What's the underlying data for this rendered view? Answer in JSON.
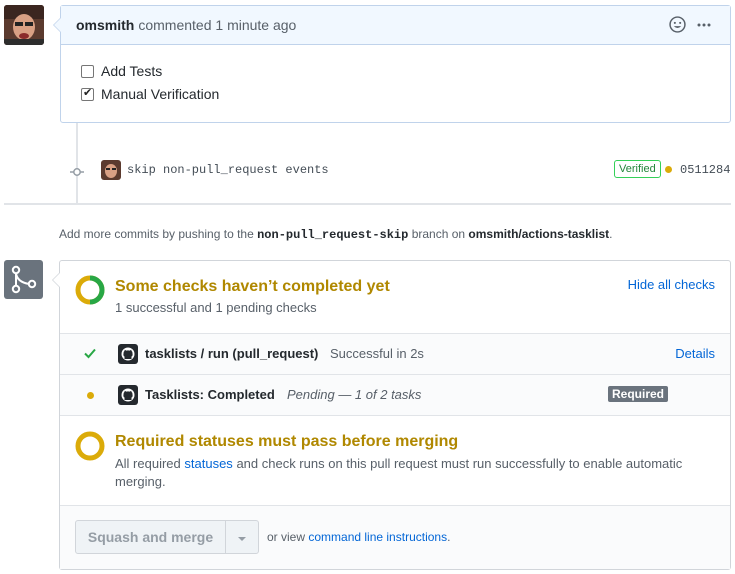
{
  "comment": {
    "author": "omsmith",
    "action": "commented",
    "time": "1 minute ago",
    "tasks": [
      {
        "label": "Add Tests",
        "checked": false
      },
      {
        "label": "Manual Verification",
        "checked": true
      }
    ]
  },
  "commit": {
    "message": "skip non-pull_request events",
    "verified_label": "Verified",
    "sha": "0511284"
  },
  "push_hint": {
    "prefix": "Add more commits by pushing to the",
    "branch": "non-pull_request-skip",
    "middle": "branch on",
    "repo": "omsmith/actions-tasklist",
    "suffix": "."
  },
  "checks": {
    "title": "Some checks haven’t completed yet",
    "summary": "1 successful and 1 pending checks",
    "toggle_label": "Hide all checks",
    "items": [
      {
        "name": "tasklists / run (pull_request)",
        "status": "Successful in 2s",
        "action": "Details"
      },
      {
        "name": "Tasklists: Completed",
        "status": "Pending — 1 of 2 tasks",
        "badge": "Required"
      }
    ]
  },
  "required": {
    "title": "Required statuses must pass before merging",
    "text_before": "All required",
    "link": "statuses",
    "text_after": "and check runs on this pull request must run successfully to enable automatic merging."
  },
  "merge": {
    "button_label": "Squash and merge",
    "view_prefix": "or view",
    "view_link": "command line instructions",
    "view_suffix": "."
  },
  "colors": {
    "success": "#28a745",
    "pending": "#dbab09",
    "link": "#0366d6",
    "pending_title": "#b08800"
  }
}
